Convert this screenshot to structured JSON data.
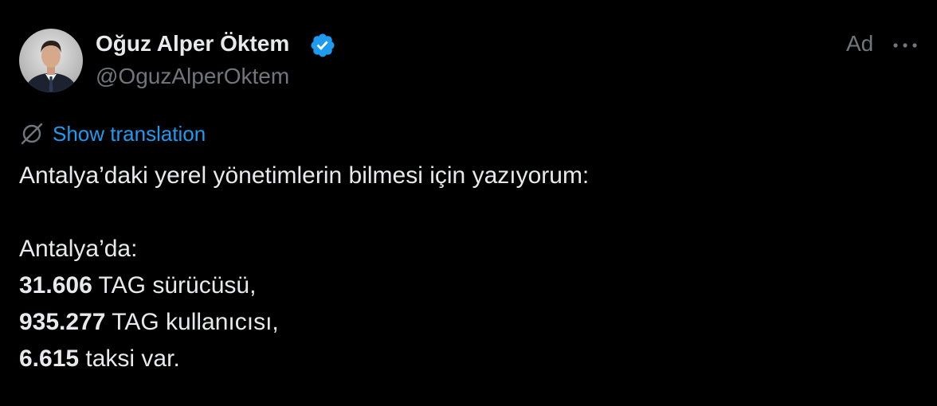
{
  "tweet": {
    "author": {
      "display_name": "Oğuz Alper Öktem",
      "handle": "@OguzAlperOktem",
      "avatar_icon": "avatar-photo",
      "verified_icon": "verified-badge-icon",
      "verified_color": "#1d9bf0"
    },
    "ad_label": "Ad",
    "more_icon": "more-options-icon",
    "translation": {
      "icon": "translate-globe-icon",
      "link": "Show translation",
      "color": "#1d9bf0"
    },
    "body": {
      "intro": "Antalya’daki yerel yönetimlerin bilmesi için yazıyorum:",
      "heading": "Antalya’da:",
      "items": [
        {
          "number": "31.606",
          "text": " TAG sürücüsü,"
        },
        {
          "number": "935.277",
          "text": " TAG kullanıcısı,"
        },
        {
          "number": "6.615",
          "text": " taksi var."
        }
      ]
    }
  },
  "colors": {
    "background": "#000000",
    "primary_text": "#e7e9ea",
    "secondary_text": "#71767b",
    "accent": "#1d9bf0"
  }
}
